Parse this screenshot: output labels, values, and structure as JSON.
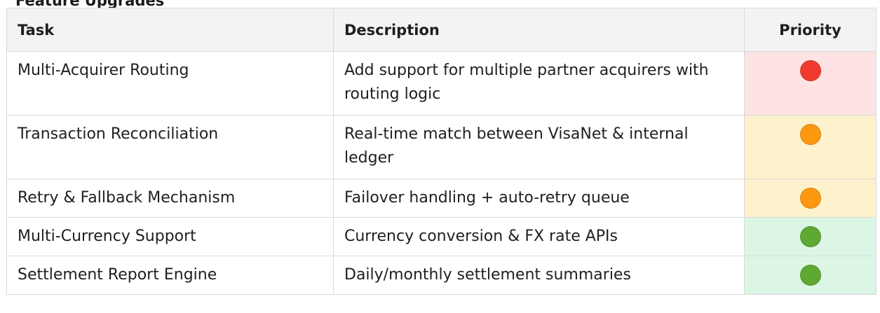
{
  "heading": "Feature Upgrades",
  "columns": {
    "task": "Task",
    "description": "Description",
    "priority": "Priority"
  },
  "rows": [
    {
      "task": "Multi-Acquirer Routing",
      "description": "Add support for multiple partner acquirers with routing logic",
      "priority": "high"
    },
    {
      "task": "Transaction Reconciliation",
      "description": "Real-time match between VisaNet & internal ledger",
      "priority": "medium"
    },
    {
      "task": "Retry & Fallback Mechanism",
      "description": "Failover handling + auto-retry queue",
      "priority": "medium"
    },
    {
      "task": "Multi-Currency Support",
      "description": "Currency conversion & FX rate APIs",
      "priority": "low"
    },
    {
      "task": "Settlement Report Engine",
      "description": "Daily/monthly settlement summaries",
      "priority": "low"
    }
  ],
  "priority_styles": {
    "high": {
      "icon": "red-circle-icon",
      "dot_color": "#f03a2f",
      "cell_bg": "#fde3e3"
    },
    "medium": {
      "icon": "orange-circle-icon",
      "dot_color": "#ff9811",
      "cell_bg": "#fdf2cc"
    },
    "low": {
      "icon": "green-circle-icon",
      "dot_color": "#5fa832",
      "cell_bg": "#dcf6e6"
    }
  }
}
